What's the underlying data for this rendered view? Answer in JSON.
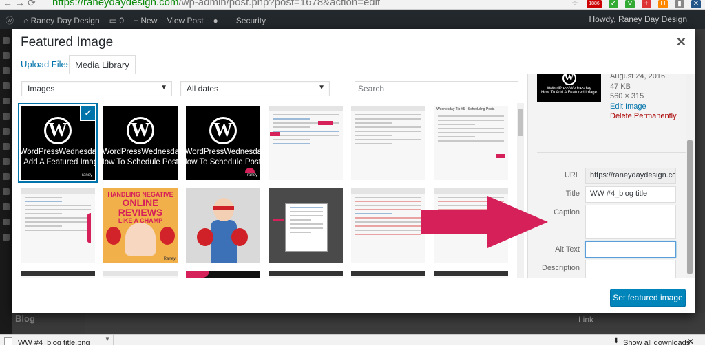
{
  "browser": {
    "url_host": "https://raneydaydesign.com",
    "url_path": "/wp-admin/post.php?post=1678&action=edit",
    "ext_badge": "1886"
  },
  "adminbar": {
    "site_name": "Raney Day Design",
    "comments": "0",
    "new_label": "New",
    "view_post": "View Post",
    "security": "Security",
    "howdy": "Howdy, Raney Day Design"
  },
  "modal": {
    "title": "Featured Image",
    "tabs": [
      "Upload Files",
      "Media Library"
    ],
    "filter_type": "Images",
    "filter_date": "All dates",
    "search_placeholder": "Search",
    "submit": "Set featured image"
  },
  "grid": {
    "tiles": [
      {
        "kind": "wp",
        "line1": "#WordPressWednesday",
        "line2": "To Add A Featured Image",
        "brand": "raney",
        "selected": true
      },
      {
        "kind": "wp",
        "line1": "#WordPressWednesday",
        "line2": "How To Schedule Posts"
      },
      {
        "kind": "wp",
        "line1": "#WordPressWednesday",
        "line2": "How To Schedule Posts",
        "brand": "raney"
      },
      {
        "kind": "screenshot"
      },
      {
        "kind": "screenshot"
      },
      {
        "kind": "screenshot",
        "caption": "Wednesday Tip #5 - Scheduling Posts"
      },
      {
        "kind": "screenshot"
      },
      {
        "kind": "promo",
        "line1": "HANDLING NEGATIVE",
        "line2": "ONLINE REVIEWS",
        "line3": "LIKE A CHAMP",
        "brand": "Raney"
      },
      {
        "kind": "photo"
      },
      {
        "kind": "screenshot-dark"
      },
      {
        "kind": "screenshot"
      },
      {
        "kind": "screenshot"
      }
    ]
  },
  "details": {
    "date": "August 24, 2016",
    "size": "47 KB",
    "dimensions": "560 × 315",
    "thumb_line1": "#WordPressWednesday",
    "thumb_line2": "How To Add A Featured Image",
    "edit": "Edit Image",
    "delete": "Delete Permanently",
    "fields": {
      "url_label": "URL",
      "url_value": "https://raneydaydesign.com",
      "title_label": "Title",
      "title_value": "WW #4_blog title",
      "caption_label": "Caption",
      "caption_value": "",
      "alt_label": "Alt Text",
      "alt_value": "",
      "desc_label": "Description",
      "desc_value": ""
    }
  },
  "background": {
    "link": "Link",
    "blog": "Blog"
  },
  "downloads": {
    "file": "WW #4_blog title.png",
    "show_all": "Show all downloads"
  },
  "colors": {
    "accent": "#0073aa",
    "primary_button": "#0085ba",
    "annotation_arrow": "#d6205a"
  }
}
